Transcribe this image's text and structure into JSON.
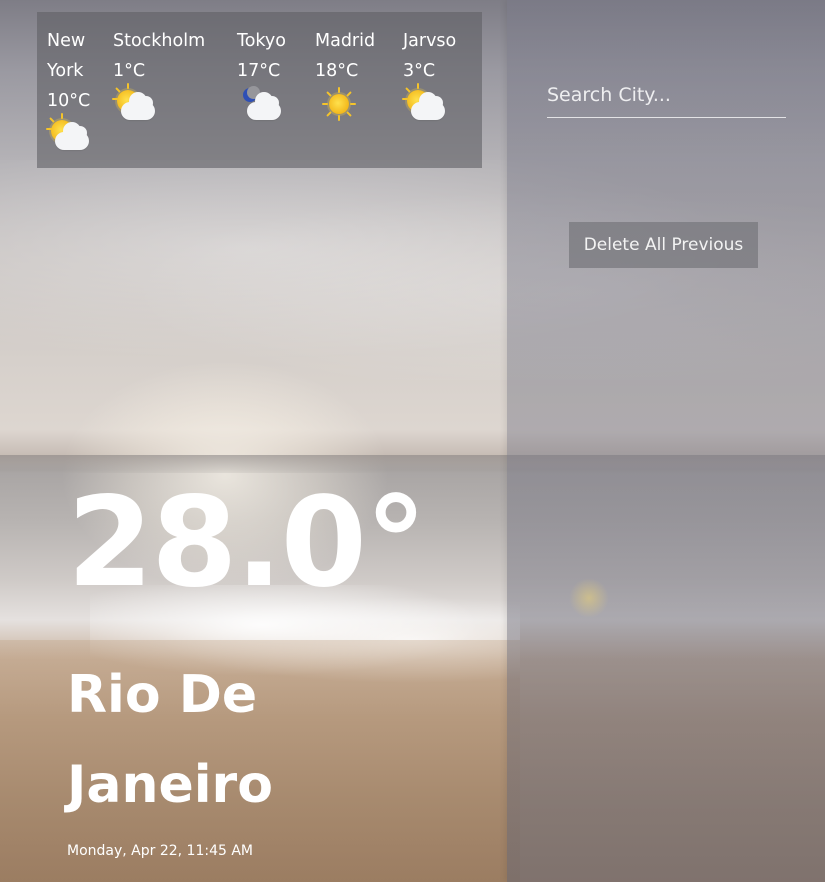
{
  "forecast_strip": {
    "cities": [
      {
        "name_line1": "New",
        "name_line2": "York",
        "temp": "10°C",
        "icon": "partly-cloudy-day-icon"
      },
      {
        "name_line1": "Stockholm",
        "name_line2": "",
        "temp": "1°C",
        "icon": "partly-cloudy-day-icon"
      },
      {
        "name_line1": "Tokyo",
        "name_line2": "",
        "temp": "17°C",
        "icon": "partly-cloudy-night-icon"
      },
      {
        "name_line1": "Madrid",
        "name_line2": "",
        "temp": "18°C",
        "icon": "sunny-icon"
      },
      {
        "name_line1": "Jarvso",
        "name_line2": "",
        "temp": "3°C",
        "icon": "partly-cloudy-day-icon"
      }
    ]
  },
  "current": {
    "temperature": "28.0°",
    "city_line1": "Rio De",
    "city_line2": "Janeiro",
    "datetime": "Monday, Apr 22, 11:45 AM"
  },
  "sidebar": {
    "search_placeholder": "Search City...",
    "delete_button_label": "Delete All Previous"
  },
  "colors": {
    "text": "#ffffff",
    "sun": "#f3b81b",
    "cloud": "#f4f5f7",
    "moon": "#2e4fb5"
  }
}
